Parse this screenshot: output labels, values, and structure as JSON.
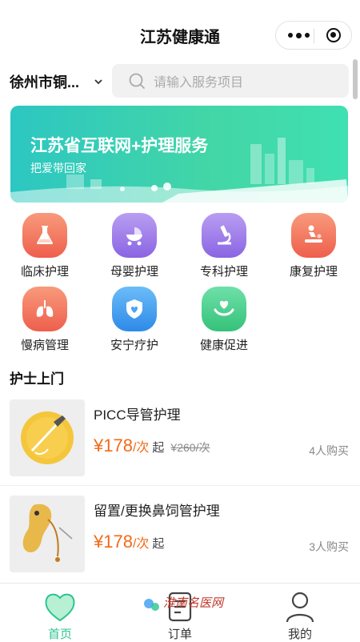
{
  "header": {
    "title": "江苏健康通"
  },
  "location": {
    "city": "徐州市铜..."
  },
  "search": {
    "placeholder": "请输入服务项目"
  },
  "banner": {
    "title": "江苏省互联网+护理服务",
    "subtitle": "把爱带回家"
  },
  "categories": [
    {
      "label": "临床护理",
      "icon": "flask-icon",
      "color": "#f2705a"
    },
    {
      "label": "母婴护理",
      "icon": "stroller-icon",
      "color": "#9b7ae8"
    },
    {
      "label": "专科护理",
      "icon": "microscope-icon",
      "color": "#9b7ae8"
    },
    {
      "label": "康复护理",
      "icon": "massage-icon",
      "color": "#f2705a"
    },
    {
      "label": "慢病管理",
      "icon": "lungs-icon",
      "color": "#f2705a"
    },
    {
      "label": "安宁疗护",
      "icon": "shield-heart-icon",
      "color": "#3a9cf0"
    },
    {
      "label": "健康促进",
      "icon": "hand-heart-icon",
      "color": "#3fcf86"
    }
  ],
  "section": {
    "title": "护士上门"
  },
  "services": [
    {
      "title": "PICC导管护理",
      "price": "¥178",
      "unit": "/次",
      "from": "起",
      "original": "¥260/次",
      "bought": "4人购买"
    },
    {
      "title": "留置/更换鼻饲管护理",
      "price": "¥178",
      "unit": "/次",
      "from": "起",
      "original": "",
      "bought": "3人购买"
    }
  ],
  "tabbar": {
    "tabs": [
      {
        "label": "首页"
      },
      {
        "label": "订单"
      },
      {
        "label": "我的"
      }
    ],
    "watermark": "淮南名医网"
  },
  "colors": {
    "accent": "#2cc48f",
    "price": "#f26a18"
  }
}
